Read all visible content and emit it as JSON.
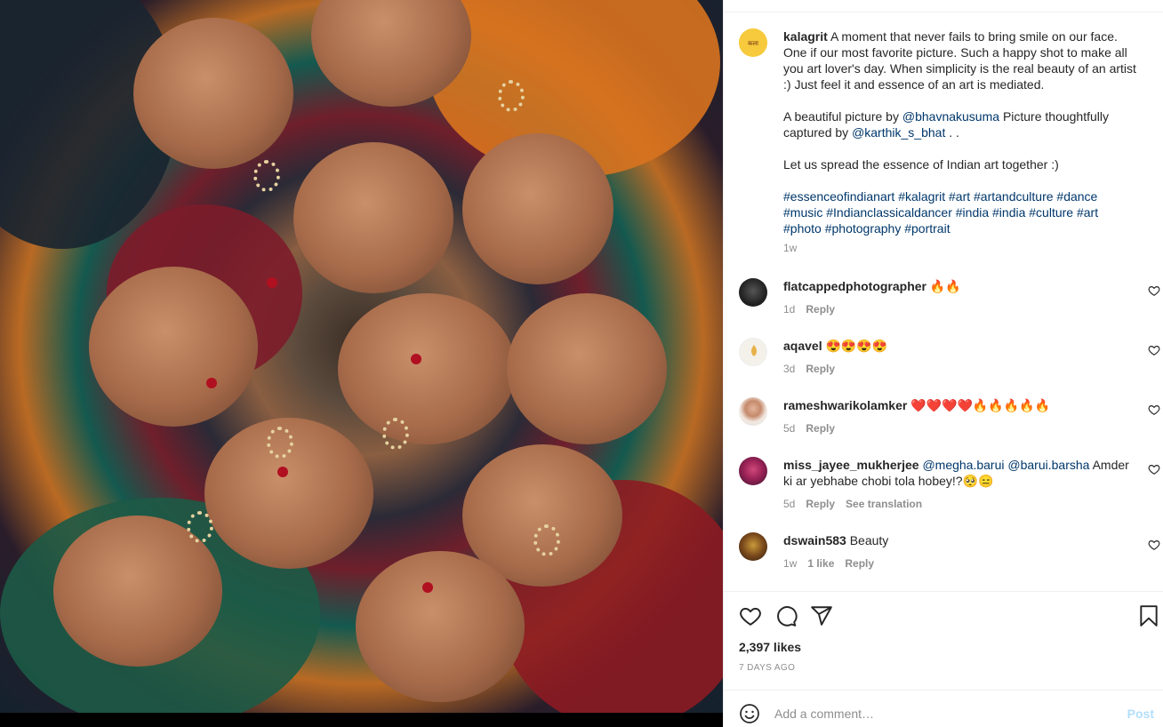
{
  "caption": {
    "username": "kalagrit",
    "text1": "A moment that never fails to bring smile on our face. One if our most favorite picture. Such a happy shot to make all you art lover's day. When simplicity is the real beauty of an artist :) Just feel it and essence of an art is mediated.",
    "text2_pre": "A beautiful picture by",
    "mention1": "@bhavnakusuma",
    "text2_mid": "Picture thoughtfully captured by",
    "mention2": "@karthik_s_bhat",
    "text2_post": ". .",
    "text3": "Let us spread the essence of Indian art together :)",
    "hashtags": "#essenceofindianart #kalagrit #art #artandculture #dance #music #Indianclassicaldancer #india #india #culture #art #photo #photography #portrait",
    "time": "1w"
  },
  "comments": [
    {
      "username": "flatcappedphotographer",
      "text": "🔥🔥",
      "time": "1d",
      "reply": "Reply"
    },
    {
      "username": "aqavel",
      "text": "😍😍😍😍",
      "time": "3d",
      "reply": "Reply"
    },
    {
      "username": "rameshwarikolamker",
      "text": "❤️❤️❤️❤️🔥🔥🔥🔥🔥",
      "time": "5d",
      "reply": "Reply"
    },
    {
      "username": "miss_jayee_mukherjee",
      "mention1": "@megha.barui",
      "mention2": "@barui.barsha",
      "text": "Amder ki ar yebhabe chobi tola hobey!?🥺😑",
      "time": "5d",
      "reply": "Reply",
      "translate": "See translation"
    },
    {
      "username": "dswain583",
      "text": "Beauty",
      "time": "1w",
      "likes": "1 like",
      "reply": "Reply"
    }
  ],
  "likes": "2,397 likes",
  "posted": "7 DAYS AGO",
  "comment_box": {
    "placeholder": "Add a comment…",
    "post": "Post"
  },
  "colors": {
    "link": "#00376b",
    "muted": "#8e8e8e",
    "post_disabled": "#b2dffc"
  }
}
